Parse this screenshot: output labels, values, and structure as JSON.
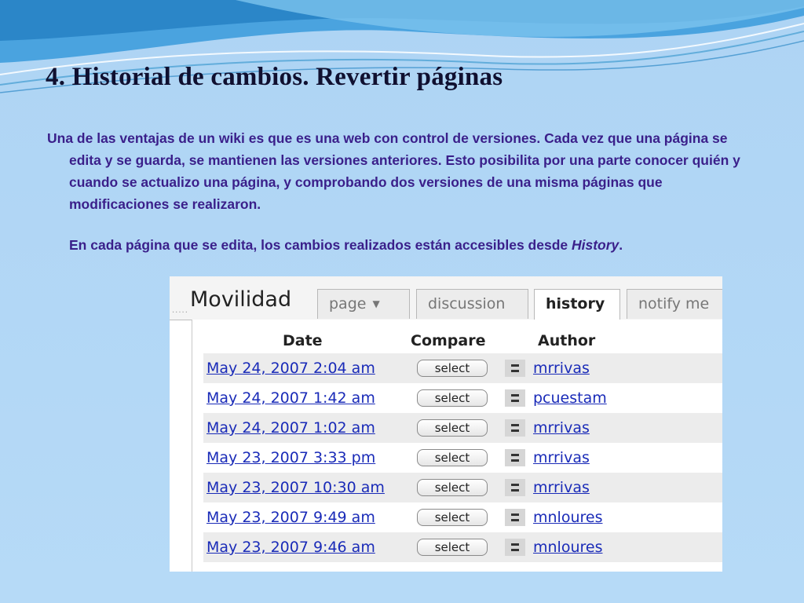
{
  "slide": {
    "title": "4. Historial de cambios. Revertir páginas",
    "paragraph1": "Una de las ventajas de un wiki es que es una web con control de versiones. Cada vez que una página se edita y se guarda, se mantienen las versiones anteriores. Esto posibilita por una parte conocer quién y cuando se actualizo una página, y comprobando dos versiones de una misma páginas que modificaciones se realizaron.",
    "paragraph2_prefix": "En cada página que se edita, los cambios realizados están accesibles desde ",
    "paragraph2_emph": "History",
    "paragraph2_suffix": "."
  },
  "wiki": {
    "page_name": "Movilidad",
    "tabs": {
      "page": "page",
      "discussion": "discussion",
      "history": "history",
      "notify": "notify me"
    },
    "active_tab": "history",
    "columns": {
      "date": "Date",
      "compare": "Compare",
      "author": "Author"
    },
    "select_label": "select",
    "rows": [
      {
        "date": "May 24, 2007 2:04 am",
        "author": "mrrivas"
      },
      {
        "date": "May 24, 2007 1:42 am",
        "author": "pcuestam"
      },
      {
        "date": "May 24, 2007 1:02 am",
        "author": "mrrivas"
      },
      {
        "date": "May 23, 2007 3:33 pm",
        "author": "mrrivas"
      },
      {
        "date": "May 23, 2007 10:30 am",
        "author": "mrrivas"
      },
      {
        "date": "May 23, 2007 9:49 am",
        "author": "mnloures"
      },
      {
        "date": "May 23, 2007 9:46 am",
        "author": "mnloures"
      }
    ],
    "icons": {
      "tab_page_dropdown": "chevron-down-icon",
      "author": "user-icon"
    }
  },
  "colors": {
    "background": "#b5d8f5",
    "body_text": "#3a1f8a",
    "link": "#1a2bb8"
  }
}
